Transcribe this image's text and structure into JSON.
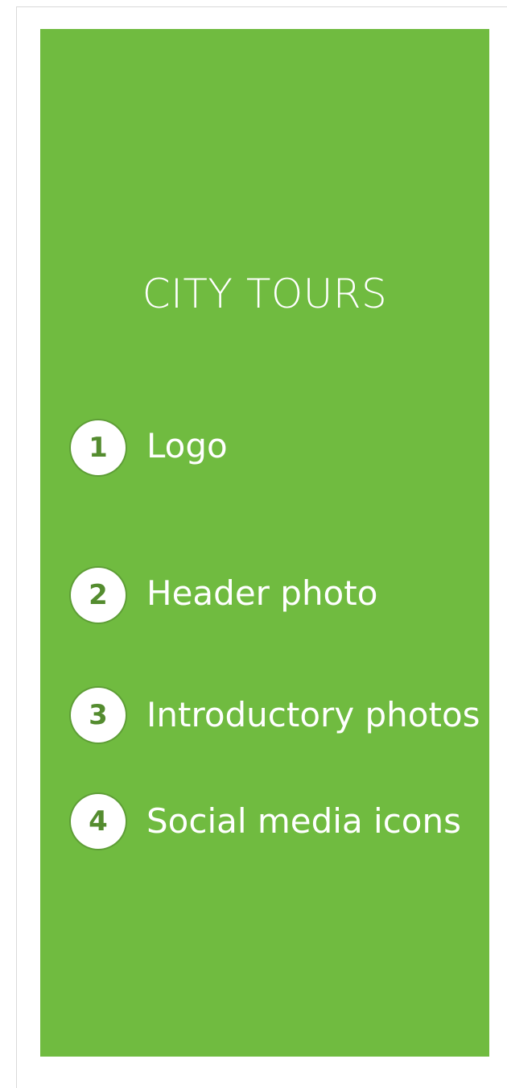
{
  "panel": {
    "background_color": "#70bb40",
    "title": "CITY TOURS"
  },
  "items": [
    {
      "number": "1",
      "label": "Logo"
    },
    {
      "number": "2",
      "label": "Header photo"
    },
    {
      "number": "3",
      "label": "Introductory photos"
    },
    {
      "number": "4",
      "label": "Social media icons"
    }
  ]
}
